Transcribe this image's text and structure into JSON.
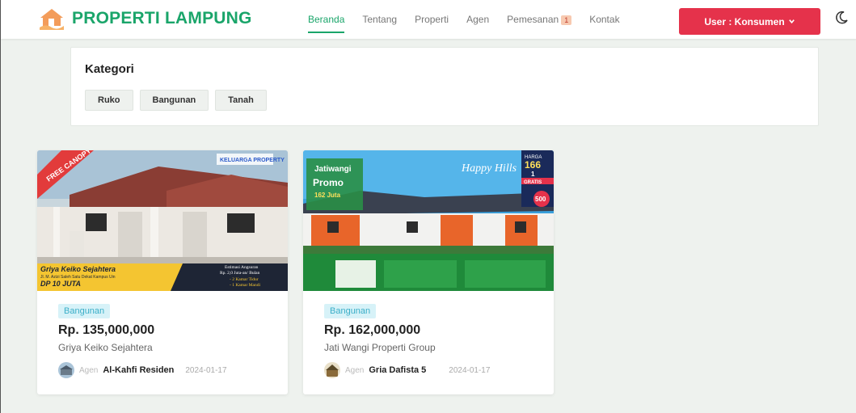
{
  "brand": {
    "name": "PROPERTI LAMPUNG",
    "color": "#1aa56a"
  },
  "nav": {
    "links": [
      "Beranda",
      "Tentang",
      "Properti",
      "Agen",
      "Pemesanan",
      "Kontak"
    ],
    "active": "Beranda",
    "pemesanan_badge": "1",
    "user_label": "User : Konsumen",
    "user_color": "#e5324b",
    "theme_icon": "moon-icon"
  },
  "kategori": {
    "title": "Kategori",
    "chips": [
      "Ruko",
      "Bangunan",
      "Tanah"
    ]
  },
  "properties": [
    {
      "category": "Bangunan",
      "price": "Rp. 135,000,000",
      "name": "Griya Keiko Sejahtera",
      "agent_prefix": "Agen",
      "agent": "Al-Kahfi Residen",
      "date": "2024-01-17",
      "image": {
        "ribbon": "FREE CANOPY",
        "banner_title": "Griya Keiko Sejahtera",
        "banner_sub": "Jl. M. Azizi Saleh Satu Dekat Kampus Uin",
        "banner_dp": "DP 10 JUTA",
        "specs_1": "Estimasi Angsuran",
        "specs_2": "Rp. 2,0 Juta-an/ Bulan",
        "specs_3": "- 2 Kamar Tidur",
        "specs_4": "- 1 Kamar Mandi",
        "logo": "KELUARGA PROPERTY"
      }
    },
    {
      "category": "Bangunan",
      "price": "Rp. 162,000,000",
      "name": "Jati Wangi Properti Group",
      "agent_prefix": "Agen",
      "agent": "Gria Dafista 5",
      "date": "2024-01-17",
      "image": {
        "banner_top": "Jatiwangi",
        "promo": "Promo",
        "promo_price": "162 Juta",
        "script": "Happy Hills",
        "harga": "HARGA",
        "harga_value": "166",
        "harga_num": "1",
        "gratis": "GRATIS",
        "dp": "500"
      }
    }
  ]
}
